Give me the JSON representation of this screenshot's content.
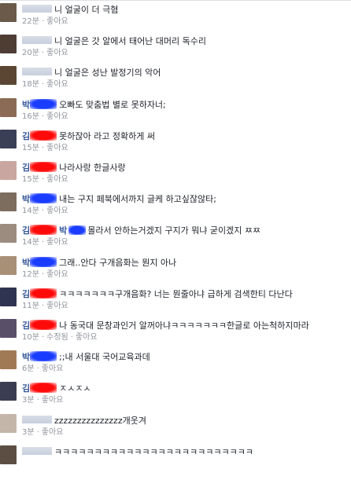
{
  "comments": [
    {
      "author_style": "grey",
      "mention": false,
      "text": "니 얼굴이 더 극혐",
      "time": "22분",
      "edited": "",
      "like": "좋아요",
      "avatar": "#6b5a4a"
    },
    {
      "author_style": "grey",
      "mention": false,
      "text": "니 얼굴은 갓 알에서 태어난 대머리 독수리",
      "time": "20분",
      "edited": "",
      "like": "좋아요",
      "avatar": "#4d3d33"
    },
    {
      "author_style": "grey",
      "mention": false,
      "text": "니 얼굴은 성난 발정기의 악어",
      "time": "18분",
      "edited": "",
      "like": "좋아요",
      "avatar": "#5b4634"
    },
    {
      "author_name": "박",
      "author_style": "blue",
      "mention": false,
      "text": "오빠도 맞춤법 별로 못하자너;",
      "time": "16분",
      "edited": "",
      "like": "좋아요",
      "avatar": "#8b6b55"
    },
    {
      "author_name": "김",
      "author_style": "red",
      "mention": false,
      "text": "못하잖아 라고 정확하게 써",
      "time": "15분",
      "edited": "",
      "like": "좋아요",
      "avatar": "#3a3f55"
    },
    {
      "author_name": "김",
      "author_style": "red",
      "mention": false,
      "text": "나라사랑 한글사랑",
      "time": "15분",
      "edited": "",
      "like": "좋아요",
      "avatar": "#c9a6a0"
    },
    {
      "author_name": "박",
      "author_style": "blue",
      "mention": false,
      "text": "내는 구지 페북에서까지 글케 하고싶잖않타;",
      "time": "14분",
      "edited": "",
      "like": "좋아요",
      "avatar": "#7d6d5e"
    },
    {
      "author_name": "김",
      "author_style": "red",
      "mention": true,
      "mention_name": "박",
      "text": "몰라서 안하는거겠지 구지가 뭐냐 굳이겠지 ㅉㅉ",
      "time": "14분",
      "edited": "",
      "like": "좋아요",
      "avatar": "#9c8c80"
    },
    {
      "author_name": "박",
      "author_style": "blue",
      "mention": false,
      "text": "그래..안다 구개음화는 뭔지 아나",
      "time": "12분",
      "edited": "",
      "like": "좋아요",
      "avatar": "#a89076"
    },
    {
      "author_name": "김",
      "author_style": "red",
      "mention": false,
      "text": "ㅋㅋㅋㅋㅋㅋㅋ구개음화? 너는 뭔줄아냐 급하게 검색한티 다난다",
      "time": "11분",
      "edited": "",
      "like": "좋아요",
      "avatar": "#2f3450"
    },
    {
      "author_name": "김",
      "author_style": "red",
      "mention": false,
      "text": "나 동국대 문창과인거 알꺼아냐ㅋㅋㅋㅋㅋㅋㅋ한글로 아는척하지마라",
      "time": "10분",
      "edited": "수정됨",
      "like": "좋아요",
      "avatar": "#5a4f68"
    },
    {
      "author_name": "박",
      "author_style": "blue",
      "mention": false,
      "text": ";;내 서울대 국어교육과데",
      "time": "6분",
      "edited": "",
      "like": "좋아요",
      "avatar": "#a07a55"
    },
    {
      "author_name": "김",
      "author_style": "red",
      "mention": false,
      "text": "ㅈㅅㅈㅅ",
      "time": "3분",
      "edited": "",
      "like": "좋아요",
      "avatar": "#3b3d52"
    },
    {
      "author_style": "grey",
      "mention": false,
      "text": "zzzzzzzzzzzzzzz개웃겨",
      "time": "3분",
      "edited": "",
      "like": "좋아요",
      "avatar": "#c4b6a8"
    },
    {
      "author_style": "grey",
      "mention": false,
      "text": "ㅋㅋㅋㅋㅋㅋㅋㅋㅋㅋㅋㅋㅋㅋㅋㅋㅋㅋㅋㅋㅋㅋㅋㅋㅋ",
      "time": "",
      "edited": "",
      "like": "",
      "avatar": "#5c4e42"
    }
  ]
}
